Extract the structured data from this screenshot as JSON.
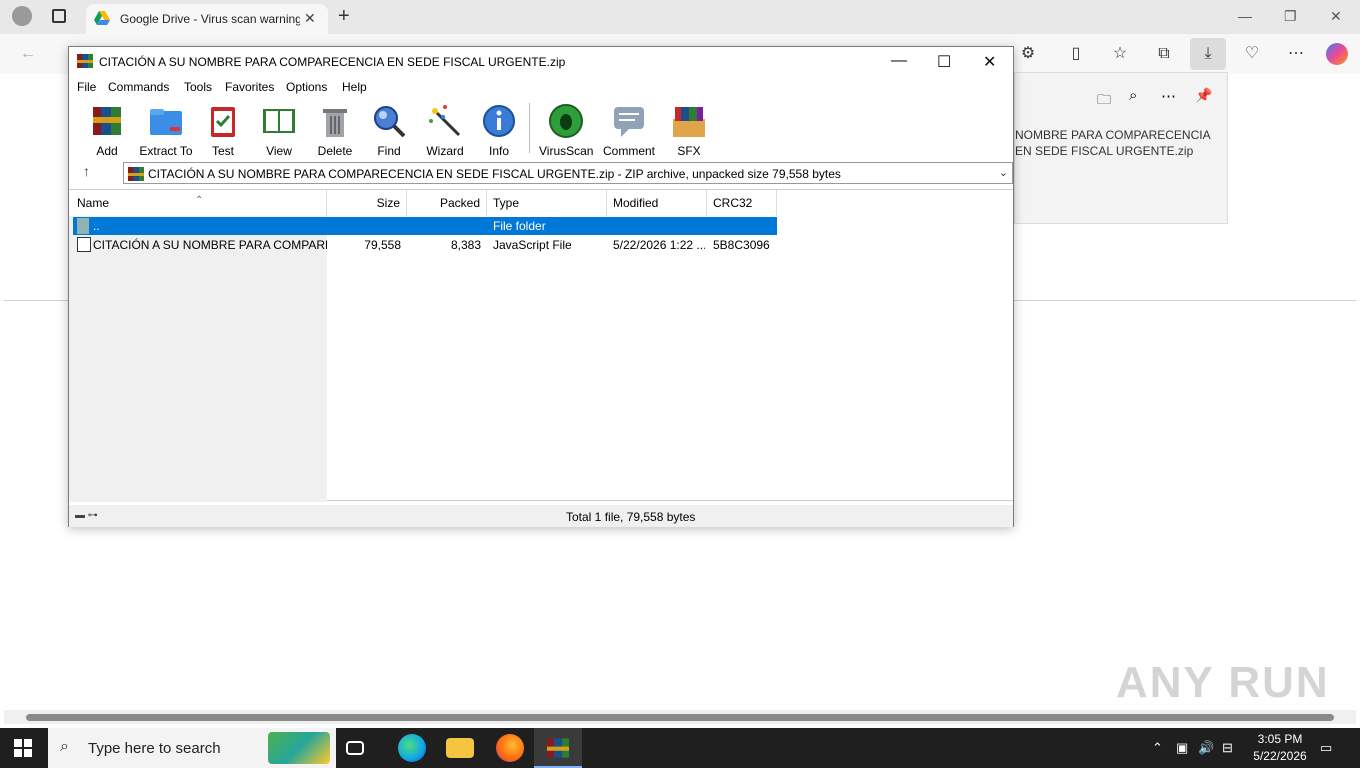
{
  "browser": {
    "tab_title": "Google Drive - Virus scan warning",
    "download_panel_text": "NOMBRE PARA COMPARECENCIA EN SEDE FISCAL URGENTE.zip"
  },
  "rar": {
    "title": "CITACIÓN A SU NOMBRE PARA COMPARECENCIA EN SEDE FISCAL URGENTE.zip",
    "menu": [
      "File",
      "Commands",
      "Tools",
      "Favorites",
      "Options",
      "Help"
    ],
    "tools": [
      "Add",
      "Extract To",
      "Test",
      "View",
      "Delete",
      "Find",
      "Wizard",
      "Info",
      "VirusScan",
      "Comment",
      "SFX"
    ],
    "path": "CITACIÓN A SU NOMBRE PARA COMPARECENCIA EN SEDE FISCAL URGENTE.zip - ZIP archive, unpacked size 79,558 bytes",
    "columns": {
      "name": "Name",
      "size": "Size",
      "packed": "Packed",
      "type": "Type",
      "modified": "Modified",
      "crc": "CRC32"
    },
    "rows": [
      {
        "name": "..",
        "size": "",
        "packed": "",
        "type": "File folder",
        "modified": "",
        "crc": ""
      },
      {
        "name": "CITACIÓN A SU NOMBRE PARA COMPARE...",
        "size": "79,558",
        "packed": "8,383",
        "type": "JavaScript File",
        "modified": "5/22/2026 1:22 ...",
        "crc": "5B8C3096"
      }
    ],
    "status": "Total 1 file, 79,558 bytes"
  },
  "taskbar": {
    "search_placeholder": "Type here to search",
    "time": "3:05 PM",
    "date": "5/22/2026"
  },
  "watermark": "ANY RUN"
}
